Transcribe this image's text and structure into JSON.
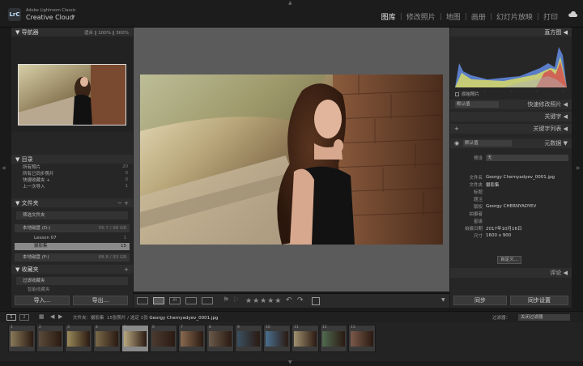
{
  "app": {
    "logo": "LrC",
    "brand_small": "Adobe Lightroom Classic",
    "brand_main": "Creative Cloud",
    "brand_arrow": "▼"
  },
  "modules": [
    "图库",
    "修改照片",
    "地图",
    "画册",
    "幻灯片放映",
    "打印"
  ],
  "active_module": "图库",
  "navigator": {
    "title": "导航器",
    "zoom": [
      "适合",
      "100%",
      "300%"
    ],
    "arrow": "▼"
  },
  "catalog": {
    "title": "目录",
    "items": [
      {
        "label": "所有照片",
        "count": "20"
      },
      {
        "label": "所有已同步照片",
        "count": "0"
      },
      {
        "label": "快捷收藏夹 +",
        "count": "0"
      },
      {
        "label": "上一次导入",
        "count": "1"
      }
    ]
  },
  "folders": {
    "title": "文件夹",
    "filter_label": "筛选文件夹",
    "volumes": [
      {
        "label": "本地磁盘 (D:)",
        "info": "56.7 / 98 GB"
      },
      {
        "label": "本地磁盘 (F:)",
        "info": "68.8 / 93 GB"
      }
    ],
    "items": [
      {
        "label": "Lesson 07",
        "count": "1"
      },
      {
        "label": "摄影集",
        "count": "15"
      }
    ]
  },
  "collections": {
    "title": "收藏夹",
    "filter_label": "过滤收藏夹",
    "next_label": "智能收藏夹"
  },
  "left_buttons": {
    "import": "导入...",
    "export": "导出..."
  },
  "histogram": {
    "title": "直方图",
    "original_label": "原始照片",
    "ticks": [
      "-",
      "-",
      "-",
      "-",
      "-"
    ]
  },
  "quick_develop": {
    "preset": "默认值",
    "title": "快速修改照片"
  },
  "keywording": {
    "title": "关键字"
  },
  "keyword_list": {
    "title": "关键字列表"
  },
  "metadata": {
    "title": "元数据",
    "preset": "默认值",
    "preset_label": "预设",
    "preset_value": "无",
    "fields": [
      {
        "label": "文件名",
        "value": "Georgy Chernyadyev_0001.jpg"
      },
      {
        "label": "文件夹",
        "value": "摄影集"
      },
      {
        "label": "标题",
        "value": ""
      },
      {
        "label": "题注",
        "value": ""
      },
      {
        "label": "版权",
        "value": "Georgy CHERNYADYEV"
      },
      {
        "label": "拍摄者",
        "value": ""
      },
      {
        "label": "星级",
        "value": ""
      },
      {
        "label": "拍摄日期",
        "value": "2017年10月16日"
      },
      {
        "label": "尺寸",
        "value": "1600 x 900"
      }
    ],
    "customize": "自定义..."
  },
  "comments": {
    "title": "评论"
  },
  "right_buttons": {
    "sync": "同步",
    "sync_settings": "同步设置"
  },
  "toolbar": {
    "stars": "★★★★★"
  },
  "filmstrip": {
    "page1": "1",
    "page2": "2",
    "folder_label": "文件夹：摄影集",
    "count_label": "15张照片 / 选定 1张",
    "filename": "Georgy Chernyadyev_0001.jpg",
    "filter_label": "过滤器：",
    "filter_value": "关闭过滤器",
    "thumbs": [
      "1",
      "2",
      "3",
      "4",
      "5",
      "6",
      "7",
      "8",
      "9",
      "10",
      "11",
      "12",
      "13"
    ]
  }
}
